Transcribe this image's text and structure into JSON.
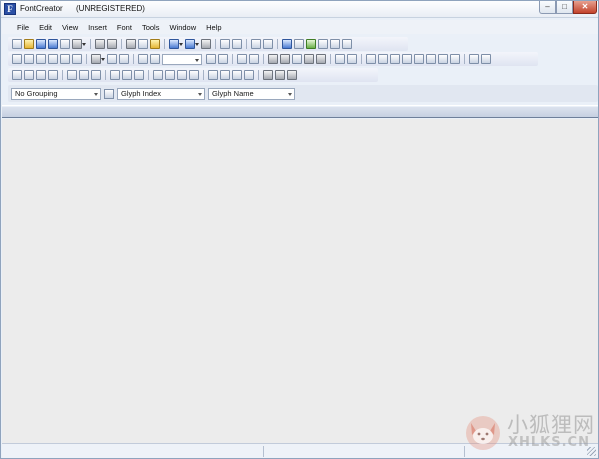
{
  "window": {
    "app_name": "FontCreator",
    "status": "(UNREGISTERED)",
    "app_icon_glyph": "F"
  },
  "window_buttons": {
    "minimize_glyph": "–",
    "maximize_glyph": "□",
    "close_glyph": "✕"
  },
  "menu": [
    "File",
    "Edit",
    "View",
    "Insert",
    "Font",
    "Tools",
    "Window",
    "Help"
  ],
  "filters": {
    "grouping": "No Grouping",
    "index": "Glyph Index",
    "name": "Glyph Name"
  },
  "watermark": {
    "cn": "小狐狸网",
    "en": "XHLKS.CN"
  },
  "colors": {
    "chrome": "#eaf0f8",
    "workspace": "#ececec",
    "close_button": "#c2422b",
    "app_icon": "#2a4fa5"
  }
}
